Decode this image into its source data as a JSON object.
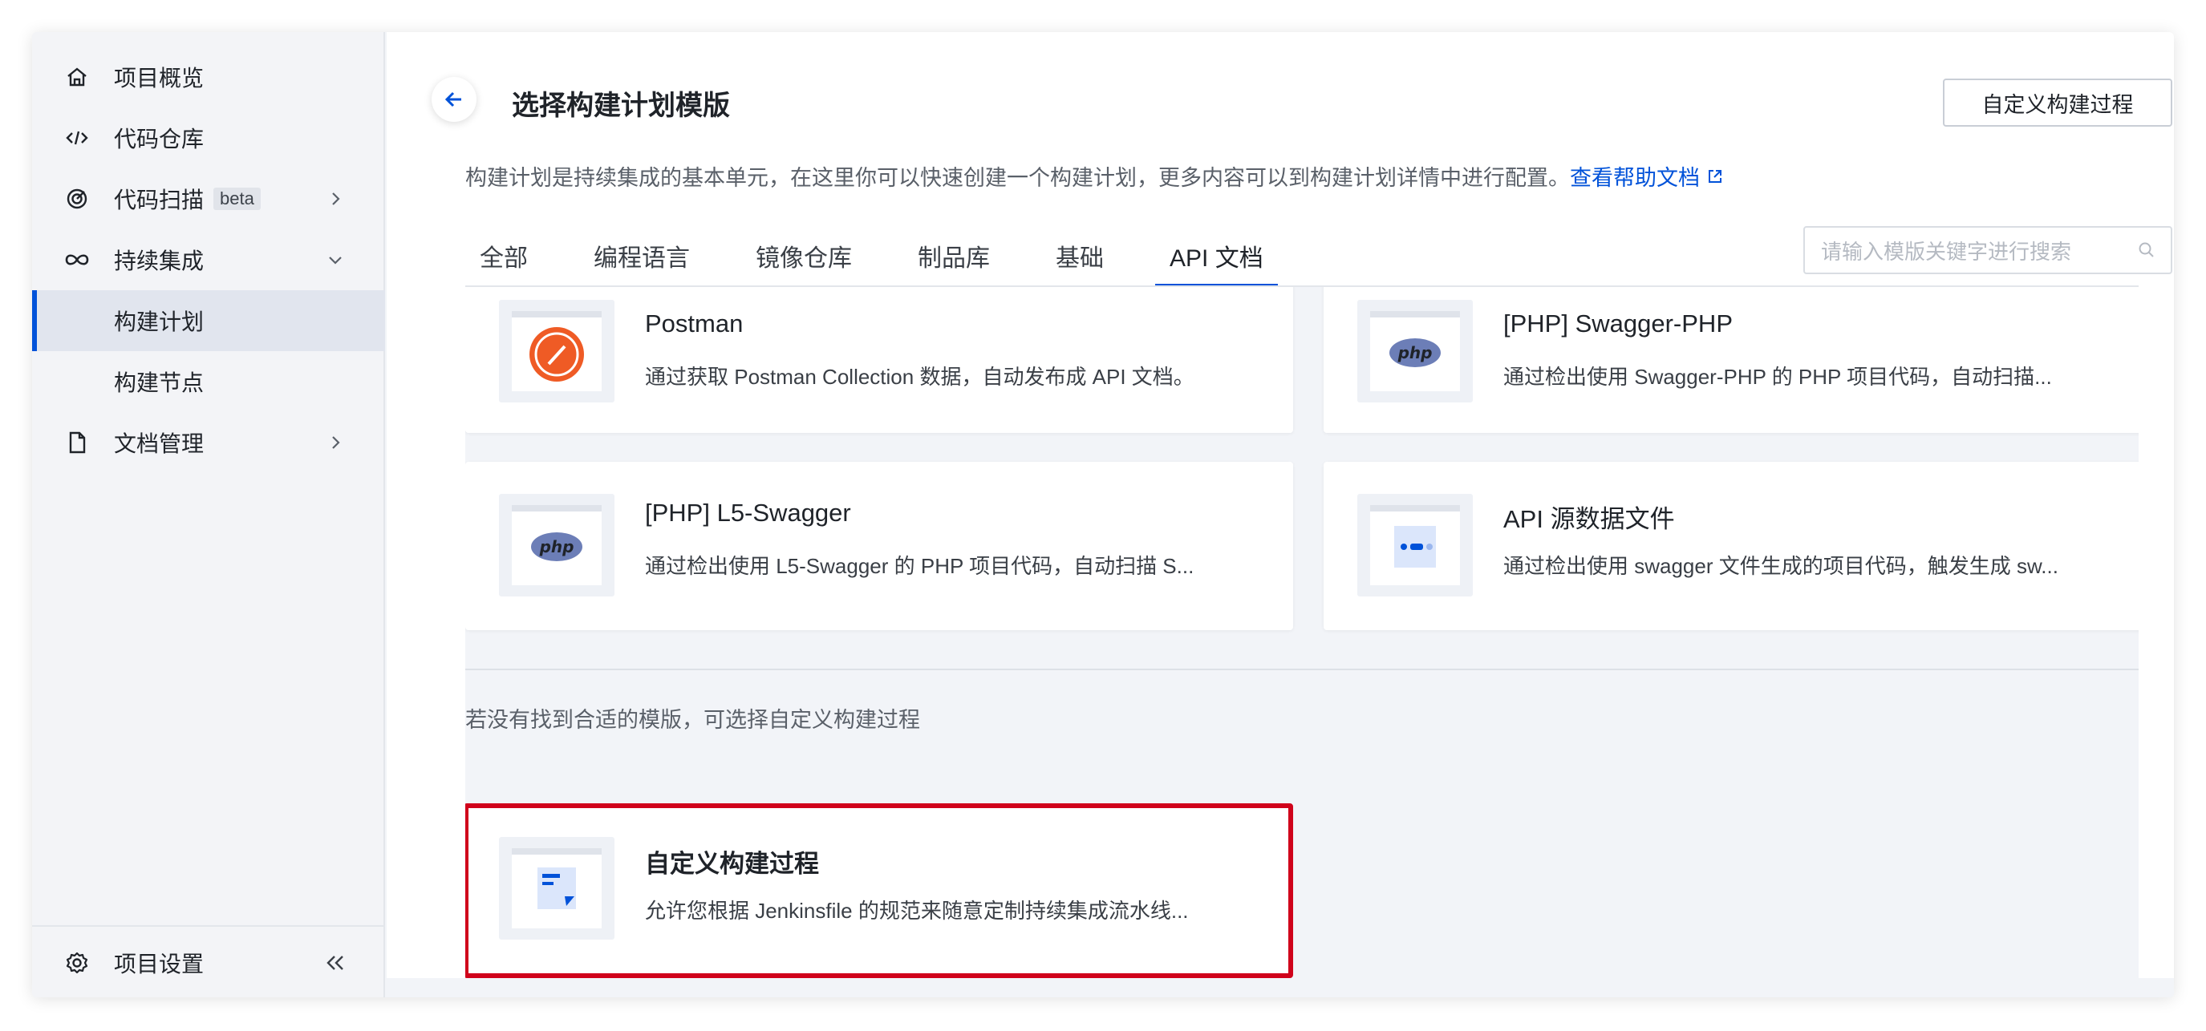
{
  "sidebar": {
    "items": [
      {
        "label": "项目概览",
        "icon": "home-icon"
      },
      {
        "label": "代码仓库",
        "icon": "code-icon"
      },
      {
        "label": "代码扫描",
        "badge": "beta",
        "icon": "scan-icon"
      },
      {
        "label": "持续集成",
        "icon": "infinity-icon"
      },
      {
        "label": "构建计划"
      },
      {
        "label": "构建节点"
      },
      {
        "label": "文档管理",
        "icon": "document-icon"
      }
    ],
    "footer_label": "项目设置"
  },
  "header": {
    "title": "选择构建计划模版",
    "custom_button": "自定义构建过程",
    "description": "构建计划是持续集成的基本单元，在这里你可以快速创建一个构建计划，更多内容可以到构建计划详情中进行配置。",
    "help_link": "查看帮助文档"
  },
  "tabs": [
    "全部",
    "编程语言",
    "镜像仓库",
    "制品库",
    "基础",
    "API 文档"
  ],
  "active_tab": "API 文档",
  "search": {
    "placeholder": "请输入模版关键字进行搜索"
  },
  "templates": [
    {
      "title": "Postman",
      "desc": "通过获取 Postman Collection 数据，自动发布成 API 文档。",
      "icon": "postman-icon"
    },
    {
      "title": "[PHP] Swagger-PHP",
      "desc": "通过检出使用 Swagger-PHP 的 PHP 项目代码，自动扫描...",
      "icon": "php-icon"
    },
    {
      "title": "[PHP] L5-Swagger",
      "desc": "通过检出使用 L5-Swagger 的 PHP 项目代码，自动扫描 S...",
      "icon": "php-icon"
    },
    {
      "title": "API 源数据文件",
      "desc": "通过检出使用 swagger 文件生成的项目代码，触发生成 sw...",
      "icon": "data-file-icon"
    }
  ],
  "hint": "若没有找到合适的模版，可选择自定义构建过程",
  "custom_template": {
    "title": "自定义构建过程",
    "desc": "允许您根据 Jenkinsfile 的规范来随意定制持续集成流水线..."
  },
  "colors": {
    "accent": "#0052d9",
    "highlight": "#d0021b"
  }
}
